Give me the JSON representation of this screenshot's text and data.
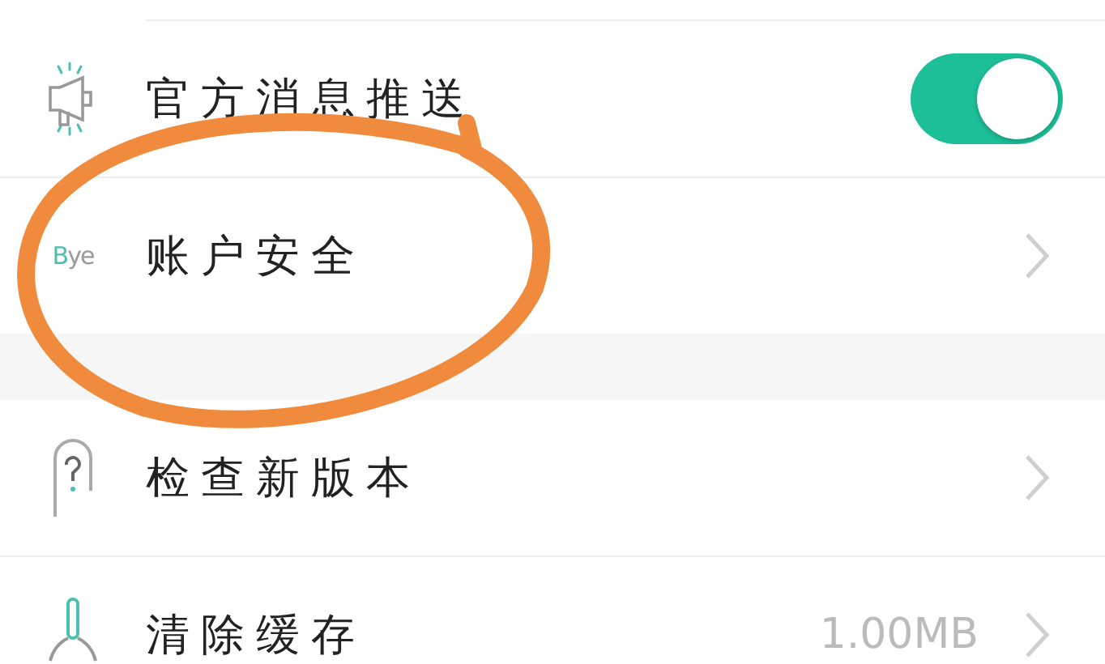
{
  "sections": [
    {
      "items": [
        {
          "kind": "toggle",
          "label": "官方消息推送",
          "on": true
        },
        {
          "kind": "link",
          "logo": "Bye",
          "label": "账户安全"
        }
      ]
    },
    {
      "items": [
        {
          "kind": "link",
          "label": "检查新版本"
        },
        {
          "kind": "value",
          "label": "清除缓存",
          "value": "1.00MB"
        }
      ]
    }
  ],
  "annotation": {
    "kind": "circle"
  }
}
